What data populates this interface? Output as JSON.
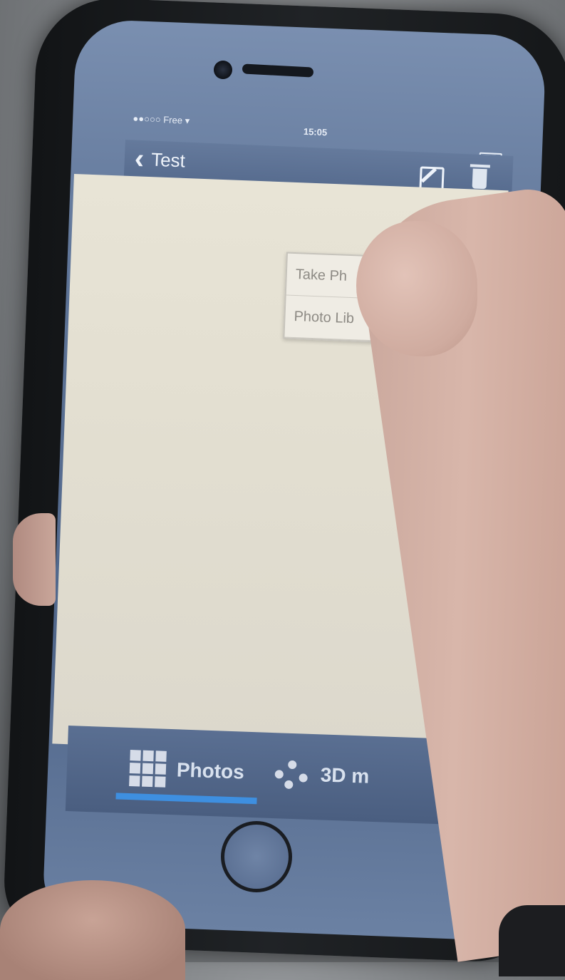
{
  "status_bar": {
    "carrier": "●●○○○ Free ▾",
    "time": "15:05"
  },
  "nav_bar": {
    "back_label": "Test",
    "back_chevron": "‹"
  },
  "popup_menu": {
    "items": [
      "Take Ph",
      "Photo Lib"
    ]
  },
  "tab_bar": {
    "tabs": [
      {
        "label": "Photos",
        "icon": "grid-icon",
        "selected": true
      },
      {
        "label": "3D m",
        "icon": "molecule-icon",
        "selected": false
      }
    ]
  },
  "colors": {
    "nav_blue": "#5a6f92",
    "tab_indicator": "#3e8fe0",
    "content_bg": "#e8e4d6"
  }
}
